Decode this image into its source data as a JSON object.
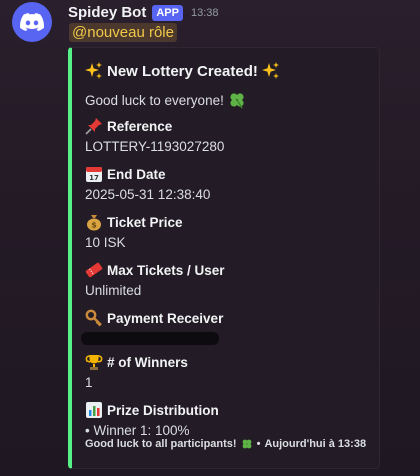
{
  "bot": {
    "name": "Spidey Bot",
    "badge": "APP",
    "time": "13:38",
    "mention": "@nouveau rôle"
  },
  "embed": {
    "accent_color": "#57f287",
    "title": "New Lottery Created!",
    "description": "Good luck to everyone!",
    "fields": [
      {
        "name": "Reference",
        "value": "LOTTERY-1193027280",
        "icon": "pushpin-icon"
      },
      {
        "name": "End Date",
        "value": "2025-05-31 12:38:40",
        "icon": "calendar-icon"
      },
      {
        "name": "Ticket Price",
        "value": "10 ISK",
        "icon": "money-bag-icon"
      },
      {
        "name": "Max Tickets / User",
        "value": "Unlimited",
        "icon": "ticket-icon"
      },
      {
        "name": "Payment Receiver",
        "value": "",
        "icon": "key-icon"
      },
      {
        "name": "# of Winners",
        "value": "1",
        "icon": "trophy-icon"
      },
      {
        "name": "Prize Distribution",
        "value": "• Winner 1: 100%",
        "icon": "bar-chart-icon"
      }
    ],
    "footer": {
      "text": "Good luck to all participants!",
      "separator": "•",
      "time": "Aujourd'hui à 13:38"
    }
  }
}
